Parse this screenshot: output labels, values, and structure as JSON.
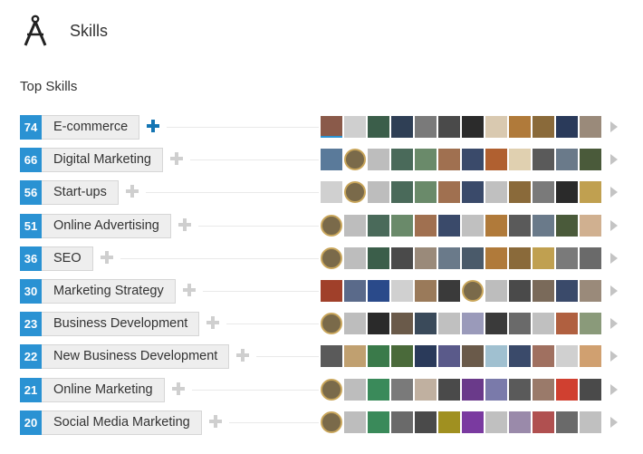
{
  "header": {
    "title": "Skills",
    "logo_icon": "compass-icon"
  },
  "section_title": "Top Skills",
  "colors": {
    "count_bg": "#2a92d3",
    "endorse_active": "#1475b3",
    "endorse_inactive": "#cfcfcf",
    "pill_bg": "#eeeeee"
  },
  "skills": [
    {
      "count": "74",
      "name": "E-commerce",
      "endorsed": true
    },
    {
      "count": "66",
      "name": "Digital Marketing",
      "endorsed": false
    },
    {
      "count": "56",
      "name": "Start-ups",
      "endorsed": false
    },
    {
      "count": "51",
      "name": "Online Advertising",
      "endorsed": false
    },
    {
      "count": "36",
      "name": "SEO",
      "endorsed": false
    },
    {
      "count": "30",
      "name": "Marketing Strategy",
      "endorsed": false
    },
    {
      "count": "23",
      "name": "Business Development",
      "endorsed": false
    },
    {
      "count": "22",
      "name": "New Business Development",
      "endorsed": false
    },
    {
      "count": "21",
      "name": "Online Marketing",
      "endorsed": false
    },
    {
      "count": "20",
      "name": "Social Media Marketing",
      "endorsed": false
    }
  ],
  "endorser_photos": [
    [
      "#8a5a4a",
      "#cfcfcf",
      "#3b5e4a",
      "#2f3f55",
      "#7a7a7a",
      "#4a4a4a",
      "#2b2b2b",
      "#d9c9b0",
      "#b07a3a",
      "#8a6a3a",
      "#2a3a5a",
      "#9a8a7a"
    ],
    [
      "#5a7a9a",
      "#c9a65b",
      "#bdbdbd",
      "#4a6a5a",
      "#6a8a6a",
      "#a07050",
      "#3a4a6a",
      "#b06030",
      "#e0d0b0",
      "#5a5a5a",
      "#6a7a8a",
      "#4a5a3a"
    ],
    [
      "#d0d0d0",
      "#c9a65b",
      "#bdbdbd",
      "#4a6a5a",
      "#6a8a6a",
      "#a07050",
      "#3a4a6a",
      "#c0c0c0",
      "#8a6a3a",
      "#7a7a7a",
      "#2a2a2a",
      "#c0a050"
    ],
    [
      "#c9a65b",
      "#bdbdbd",
      "#4a6a5a",
      "#6a8a6a",
      "#a07050",
      "#3a4a6a",
      "#c0c0c0",
      "#b07a3a",
      "#5a5a5a",
      "#6a7a8a",
      "#4a5a3a",
      "#d0b090"
    ],
    [
      "#c9a65b",
      "#bdbdbd",
      "#3b5e4a",
      "#4a4a4a",
      "#9a8a7a",
      "#6a7a8a",
      "#4a5a6a",
      "#b07a3a",
      "#8a6a3a",
      "#c0a050",
      "#7a7a7a",
      "#6a6a6a"
    ],
    [
      "#a0402a",
      "#5a6a8a",
      "#2a4a8a",
      "#d0d0d0",
      "#9a7a5a",
      "#3a3a3a",
      "#c9a65b",
      "#bdbdbd",
      "#4a4a4a",
      "#7a6a5a",
      "#3a4a6a",
      "#9a8a7a"
    ],
    [
      "#c9a65b",
      "#bdbdbd",
      "#2a2a2a",
      "#6a5a4a",
      "#3a4a5a",
      "#c0c0c0",
      "#9a9aba",
      "#3a3a3a",
      "#6a6a6a",
      "#c0c0c0",
      "#b06040",
      "#8a9a7a"
    ],
    [
      "#5a5a5a",
      "#c0a070",
      "#3a7a4a",
      "#4a6a3a",
      "#2a3a5a",
      "#5a5a8a",
      "#6a5a4a",
      "#a0c0d0",
      "#3a4a6a",
      "#a07060",
      "#d0d0d0",
      "#d0a070"
    ],
    [
      "#c9a65b",
      "#bdbdbd",
      "#3a8a5a",
      "#7a7a7a",
      "#c0b0a0",
      "#4a4a4a",
      "#6a3a8a",
      "#7a7aaa",
      "#5a5a5a",
      "#9a7a6a",
      "#d04030",
      "#4a4a4a"
    ],
    [
      "#c9a65b",
      "#bdbdbd",
      "#3a8a5a",
      "#6a6a6a",
      "#4a4a4a",
      "#a09020",
      "#7a3aa0",
      "#c0c0c0",
      "#9a8aaa",
      "#b05050",
      "#6a6a6a",
      "#c0c0c0"
    ]
  ]
}
